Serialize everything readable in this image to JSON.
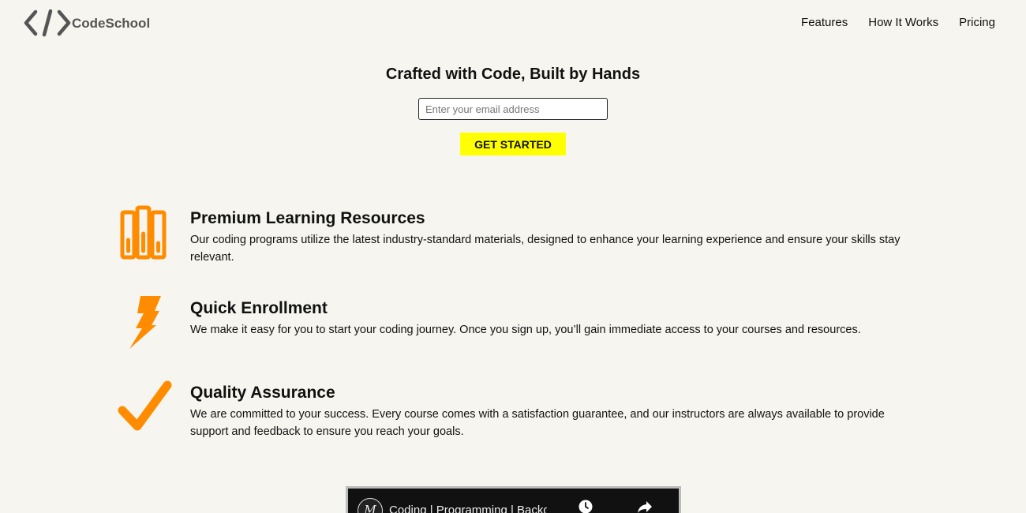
{
  "header": {
    "logo_text": "CodeSchool",
    "nav": [
      {
        "label": "Features"
      },
      {
        "label": "How It Works"
      },
      {
        "label": "Pricing"
      }
    ]
  },
  "hero": {
    "title": "Crafted with Code, Built by Hands",
    "email_placeholder": "Enter your email address",
    "email_value": "",
    "cta_label": "GET STARTED"
  },
  "features": [
    {
      "icon": "books-icon",
      "title": "Premium Learning Resources",
      "text": "Our coding programs utilize the latest industry-standard materials, designed to enhance your learning experience and ensure your skills stay relevant."
    },
    {
      "icon": "lightning-bolt-icon",
      "title": "Quick Enrollment",
      "text": "We make it easy for you to start your coding journey. Once you sign up, you’ll gain immediate access to your courses and resources."
    },
    {
      "icon": "checkmark-icon",
      "title": "Quality Assurance",
      "text": "We are committed to your success. Every course comes with a satisfaction guarantee, and our instructors are always available to provide support and feedback to ensure you reach your goals."
    }
  ],
  "video": {
    "channel_initial": "M",
    "title": "Coding | Programming | Backgr"
  },
  "colors": {
    "background": "#f6f5ef",
    "accent_orange": "#ff8c00",
    "cta_yellow": "#ffff00",
    "logo_gray": "#555555"
  }
}
